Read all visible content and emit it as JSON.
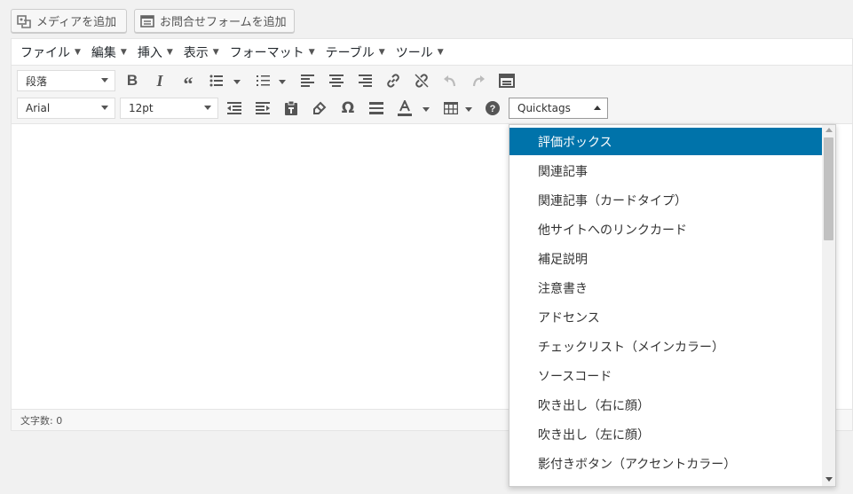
{
  "top_buttons": {
    "add_media": "メディアを追加",
    "add_form": "お問合せフォームを追加"
  },
  "menubar": {
    "items": [
      "ファイル",
      "編集",
      "挿入",
      "表示",
      "フォーマット",
      "テーブル",
      "ツール"
    ]
  },
  "toolbar": {
    "format_select": "段落",
    "font_family_select": "Arial",
    "font_size_select": "12pt",
    "quicktags_select": "Quicktags"
  },
  "statusbar": {
    "word_count": "文字数: 0"
  },
  "quicktags_dropdown": {
    "items": [
      "評価ボックス",
      "関連記事",
      "関連記事（カードタイプ）",
      "他サイトへのリンクカード",
      "補足説明",
      "注意書き",
      "アドセンス",
      "チェックリスト（メインカラー）",
      "ソースコード",
      "吹き出し（右に顔）",
      "吹き出し（左に顔）",
      "影付きボタン（アクセントカラー）"
    ],
    "selected_index": 0
  },
  "colors": {
    "accent": "#0073aa",
    "toolbar_bg": "#f5f5f5",
    "page_bg": "#f1f1f1"
  }
}
